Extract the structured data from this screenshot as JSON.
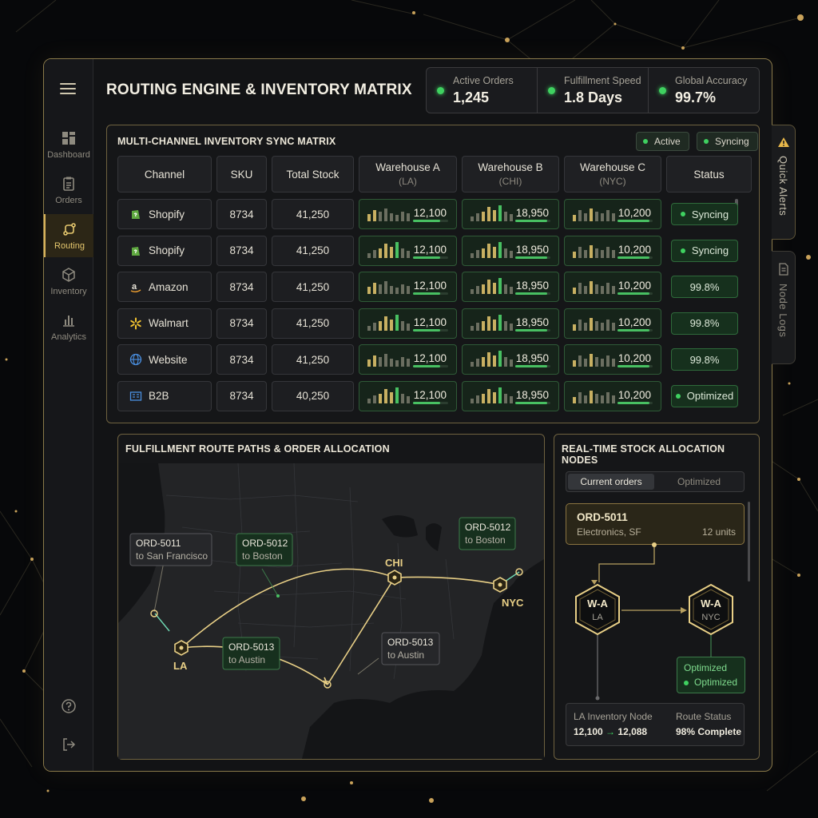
{
  "app": {
    "title": "ROUTING ENGINE & INVENTORY MATRIX"
  },
  "colors": {
    "accent_gold": "#d8b35a",
    "status_green": "#3fd160",
    "route_line": "#e8cf86"
  },
  "sidebar": {
    "menu_icon": "hamburger-icon",
    "items": [
      {
        "label": "Dashboard",
        "icon": "grid-icon"
      },
      {
        "label": "Orders",
        "icon": "clipboard-icon"
      },
      {
        "label": "Routing",
        "icon": "route-icon",
        "active": true
      },
      {
        "label": "Inventory",
        "icon": "box-icon"
      },
      {
        "label": "Analytics",
        "icon": "bar-chart-icon"
      }
    ],
    "bottom_icons": [
      "help-icon",
      "logout-icon"
    ]
  },
  "kpis": [
    {
      "label": "Active Orders",
      "value": "1,245"
    },
    {
      "label": "Fulfillment Speed",
      "value": "1.8 Days"
    },
    {
      "label": "Global Accuracy",
      "value": "99.7%"
    }
  ],
  "matrix": {
    "title": "MULTI-CHANNEL INVENTORY SYNC MATRIX",
    "pills": [
      "Active",
      "Syncing"
    ],
    "headers": {
      "channel": "Channel",
      "sku": "SKU",
      "total": "Total Stock",
      "wa": "Warehouse A",
      "wa_sub": "(LA)",
      "wb": "Warehouse B",
      "wb_sub": "(CHI)",
      "wc": "Warehouse C",
      "wc_sub": "(NYC)",
      "status": "Status"
    },
    "rows": [
      {
        "channel": "Shopify",
        "icon": "shopify-icon",
        "sku": "8734",
        "total": "41,250",
        "wa": "12,100",
        "wb": "18,950",
        "wc": "10,200",
        "status": "Syncing",
        "dot": true
      },
      {
        "channel": "Shopify",
        "icon": "shopify-icon",
        "sku": "8734",
        "total": "41,250",
        "wa": "12,100",
        "wb": "18,950",
        "wc": "10,200",
        "status": "Syncing",
        "dot": true
      },
      {
        "channel": "Amazon",
        "icon": "amazon-icon",
        "sku": "8734",
        "total": "41,250",
        "wa": "12,100",
        "wb": "18,950",
        "wc": "10,200",
        "status": "99.8%",
        "dot": false
      },
      {
        "channel": "Walmart",
        "icon": "walmart-icon",
        "sku": "8734",
        "total": "41,250",
        "wa": "12,100",
        "wb": "18,950",
        "wc": "10,200",
        "status": "99.8%",
        "dot": false
      },
      {
        "channel": "Website",
        "icon": "globe-icon",
        "sku": "8734",
        "total": "41,250",
        "wa": "12,100",
        "wb": "18,950",
        "wc": "10,200",
        "status": "99.8%",
        "dot": false
      },
      {
        "channel": "B2B",
        "icon": "b2b-icon",
        "sku": "8734",
        "total": "40,250",
        "wa": "12,100",
        "wb": "18,950",
        "wc": "10,200",
        "status": "Optimized",
        "dot": true
      }
    ]
  },
  "routes": {
    "title": "FULFILLMENT ROUTE PATHS & ORDER ALLOCATION",
    "hubs": [
      "LA",
      "CHI",
      "NYC"
    ],
    "labels": [
      {
        "id": "ORD-5011",
        "dest": "to San Francisco",
        "style": "gray"
      },
      {
        "id": "ORD-5012",
        "dest": "to Boston",
        "style": "green"
      },
      {
        "id": "ORD-5012",
        "dest": "to Boston",
        "style": "green"
      },
      {
        "id": "ORD-5013",
        "dest": "to Austin",
        "style": "green"
      },
      {
        "id": "ORD-5013",
        "dest": "to Austin",
        "style": "gray"
      }
    ]
  },
  "nodes": {
    "title": "REAL-TIME STOCK ALLOCATION NODES",
    "tabs": [
      "Current orders",
      "Optimized"
    ],
    "order": {
      "id": "ORD-5011",
      "desc": "Electronics, SF",
      "units": "12 units"
    },
    "node_a": {
      "name": "W-A",
      "loc": "LA"
    },
    "node_b": {
      "name": "W-A",
      "loc": "NYC"
    },
    "optimized_box": {
      "title": "Optimized",
      "status": "Optimized"
    },
    "footer": {
      "inv_label": "LA Inventory Node",
      "inv_from": "12,100",
      "inv_to": "12,088",
      "route_label": "Route Status",
      "route_value": "98% Complete"
    }
  },
  "side_tabs": {
    "alerts": "Quick Alerts",
    "logs": "Node Logs"
  }
}
